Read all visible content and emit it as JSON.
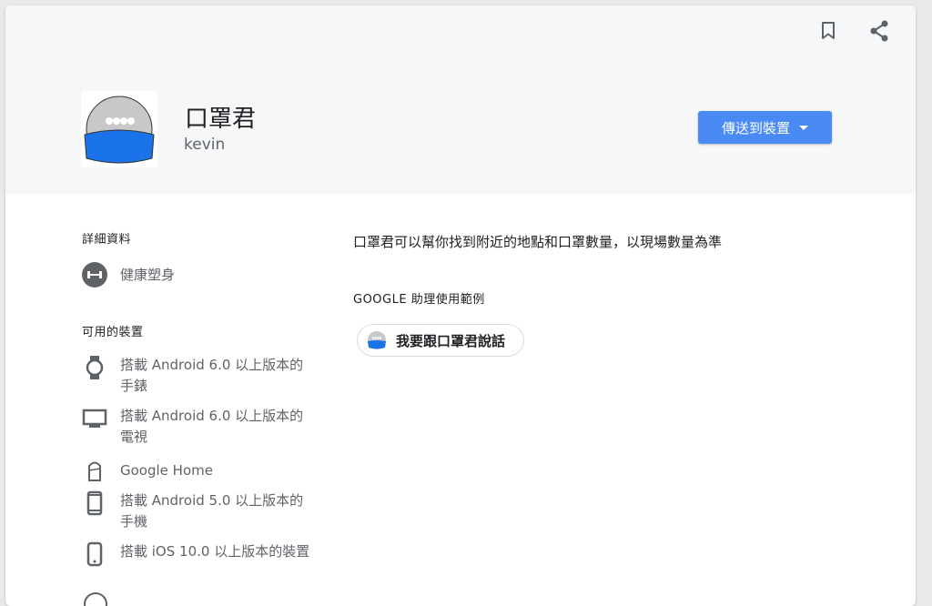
{
  "app": {
    "title": "口罩君",
    "developer": "kevin",
    "send_button_label": "傳送到裝置",
    "accent_color": "#4a8af4"
  },
  "details": {
    "section_title": "詳細資料",
    "category": "健康塑身"
  },
  "devices": {
    "section_title": "可用的裝置",
    "items": [
      {
        "icon": "watch-icon",
        "label": "搭載 Android 6.0 以上版本的手錶"
      },
      {
        "icon": "tv-icon",
        "label": "搭載 Android 6.0 以上版本的電視"
      },
      {
        "icon": "google-home-icon",
        "label": "Google Home"
      },
      {
        "icon": "android-phone-icon",
        "label": "搭載 Android 5.0 以上版本的手機"
      },
      {
        "icon": "iphone-icon",
        "label": "搭載 iOS 10.0 以上版本的裝置"
      }
    ]
  },
  "main": {
    "description": "口罩君可以幫你找到附近的地點和口罩數量，以現場數量為準",
    "examples_title": "GOOGLE 助理使用範例",
    "example_chip": "我要跟口罩君說話"
  }
}
